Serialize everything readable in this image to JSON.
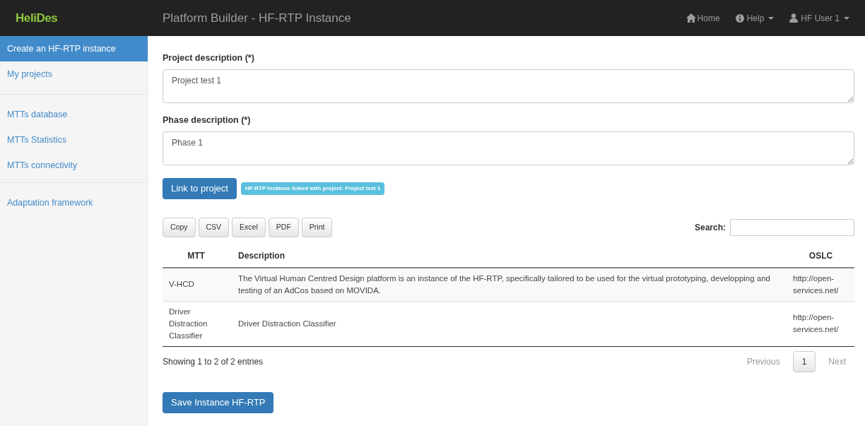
{
  "navbar": {
    "logo": "HeliDes",
    "title": "Platform Builder - HF-RTP Instance",
    "items": [
      {
        "kind": "home",
        "label": "Home",
        "dropdown": false
      },
      {
        "kind": "help",
        "label": "Help",
        "dropdown": true
      },
      {
        "kind": "user",
        "label": "HF User 1",
        "dropdown": true
      }
    ]
  },
  "sidebar": {
    "groups": [
      [
        {
          "label": "Create an HF-RTP instance",
          "selected": true
        },
        {
          "label": "My projects",
          "selected": false
        }
      ],
      [
        {
          "label": "MTTs database",
          "selected": false
        },
        {
          "label": "MTTs Statistics",
          "selected": false
        },
        {
          "label": "MTTs connectivity",
          "selected": false
        }
      ],
      [
        {
          "label": "Adaptation framework",
          "selected": false
        }
      ]
    ]
  },
  "form": {
    "fields": [
      {
        "label": "Project description (*)",
        "value": "Project test 1"
      },
      {
        "label": "Phase description (*)",
        "value": "Phase 1"
      }
    ],
    "link_button": "Link to project",
    "link_badge": "HF-RTP Instance linked with project: Project test 1"
  },
  "table_tools": {
    "buttons": [
      "Copy",
      "CSV",
      "Excel",
      "PDF",
      "Print"
    ],
    "search_label": "Search:"
  },
  "table": {
    "columns": [
      "MTT",
      "Description",
      "OSLC"
    ],
    "rows": [
      {
        "cells": [
          "V-HCD",
          "The Virtual Human Centred Design platform is an instance of the HF-RTP, specifically tailored to be used for the virtual prototyping, developping and testing of an AdCos based on MOVIDA.",
          "http://open-services.net/"
        ]
      },
      {
        "cells": [
          "Driver Distraction Classifier",
          "Driver Distraction Classifier",
          "http://open-services.net/"
        ]
      }
    ]
  },
  "footer": {
    "info": "Showing 1 to 2 of 2 entries",
    "pagination": [
      {
        "label": "Previous",
        "disabled": true,
        "selected": false
      },
      {
        "label": "1",
        "disabled": false,
        "selected": true
      },
      {
        "label": "Next",
        "disabled": true,
        "selected": false
      }
    ]
  },
  "save_button": "Save Instance HF-RTP"
}
